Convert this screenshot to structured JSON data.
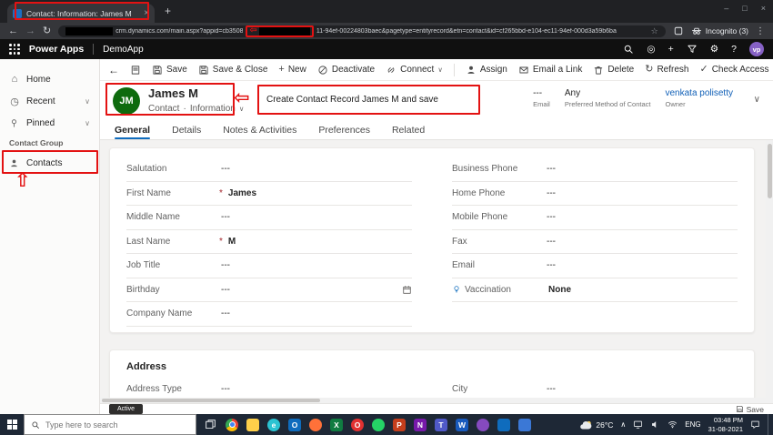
{
  "browser": {
    "tab_title": "Contact: Information: James M",
    "url": {
      "part1": "crm.dynamics.com/main.aspx?appid=cb3508",
      "part2": "11-94ef-00224803baec&pagetype=entityrecord&etn=contact&id=cf265bbd-e104-ec11-94ef-000d3a59b6ba"
    },
    "incognito_label": "Incognito (3)"
  },
  "icons": {
    "back": "←",
    "forward": "→",
    "reload": "↻",
    "close": "×",
    "new_tab": "+",
    "star": "☆",
    "menu_dots": "⋮",
    "minimize": "–",
    "maximize": "□",
    "chevron_down": "∨",
    "home": "⌂",
    "recent": "◷",
    "plus": "+",
    "gear": "⚙",
    "question": "?",
    "bullseye": "◎",
    "check": "✓",
    "refresh": "↻",
    "left_block_arrow": "⇦",
    "up_block_arrow": "⇧",
    "dot_separator": "·",
    "caret_up": "∧"
  },
  "app_header": {
    "brand": "Power Apps",
    "app_name": "DemoApp",
    "avatar_initials": "vp"
  },
  "sidebar": {
    "home": "Home",
    "recent": "Recent",
    "pinned": "Pinned",
    "group_label": "Contact Group",
    "contacts": "Contacts"
  },
  "command_bar": {
    "save": "Save",
    "save_close": "Save & Close",
    "new": "New",
    "deactivate": "Deactivate",
    "connect": "Connect",
    "assign": "Assign",
    "email_link": "Email a Link",
    "delete": "Delete",
    "refresh": "Refresh",
    "check_access": "Check Access"
  },
  "record": {
    "initials": "JM",
    "name": "James M",
    "entity": "Contact",
    "form": "Information",
    "email_value": "---",
    "email_label": "Email",
    "preferred_value": "Any",
    "preferred_label": "Preferred Method of Contact",
    "owner_value": "venkata polisetty",
    "owner_label": "Owner"
  },
  "annotations": {
    "note": "Create Contact Record James M and save"
  },
  "tabs": [
    {
      "label": "General"
    },
    {
      "label": "Details"
    },
    {
      "label": "Notes & Activities"
    },
    {
      "label": "Preferences"
    },
    {
      "label": "Related"
    }
  ],
  "form": {
    "left": [
      {
        "label": "Salutation",
        "value": "---"
      },
      {
        "label": "First Name",
        "req": "*",
        "value": "James"
      },
      {
        "label": "Middle Name",
        "value": "---"
      },
      {
        "label": "Last Name",
        "req": "*",
        "value": "M"
      },
      {
        "label": "Job Title",
        "value": "---"
      },
      {
        "label": "Birthday",
        "value": "---"
      },
      {
        "label": "Company Name",
        "value": "---"
      }
    ],
    "right": [
      {
        "label": "Business Phone",
        "value": "---"
      },
      {
        "label": "Home Phone",
        "value": "---"
      },
      {
        "label": "Mobile Phone",
        "value": "---"
      },
      {
        "label": "Fax",
        "value": "---"
      },
      {
        "label": "Email",
        "value": "---"
      },
      {
        "label": "Vaccination",
        "value": "None"
      }
    ],
    "address": {
      "title": "Address",
      "left": [
        {
          "label": "Address Type",
          "value": "---"
        }
      ],
      "right": [
        {
          "label": "City",
          "value": "---"
        }
      ]
    }
  },
  "status_bar": {
    "state": "Active",
    "save_label": "Save"
  },
  "taskbar": {
    "search_placeholder": "Type here to search",
    "weather": "26°C",
    "language": "ENG",
    "time": "03:48 PM",
    "date": "31-08-2021",
    "apps": [
      {
        "name": "chrome",
        "color": "#4285f4",
        "glyph": "",
        "shape": "circle"
      },
      {
        "name": "file-explorer",
        "color": "#ffd04a",
        "glyph": "",
        "shape": "square"
      },
      {
        "name": "edge",
        "color": "#2bc3d2",
        "glyph": "e",
        "shape": "circle"
      },
      {
        "name": "outlook",
        "color": "#0f6cbd",
        "glyph": "O",
        "shape": "square"
      },
      {
        "name": "firefox",
        "color": "#ff7139",
        "glyph": "",
        "shape": "circle"
      },
      {
        "name": "excel",
        "color": "#107c41",
        "glyph": "X",
        "shape": "square"
      },
      {
        "name": "opera",
        "color": "#e23131",
        "glyph": "O",
        "shape": "circle"
      },
      {
        "name": "whatsapp",
        "color": "#25d366",
        "glyph": "",
        "shape": "circle"
      },
      {
        "name": "powerpoint",
        "color": "#c43e1c",
        "glyph": "P",
        "shape": "square"
      },
      {
        "name": "onenote",
        "color": "#7719aa",
        "glyph": "N",
        "shape": "square"
      },
      {
        "name": "teams",
        "color": "#5059c9",
        "glyph": "T",
        "shape": "square"
      },
      {
        "name": "word",
        "color": "#185abd",
        "glyph": "W",
        "shape": "square"
      },
      {
        "name": "visual-studio",
        "color": "#864abf",
        "glyph": "",
        "shape": "circle"
      },
      {
        "name": "store",
        "color": "#0f6cbd",
        "glyph": "",
        "shape": "square"
      },
      {
        "name": "photos",
        "color": "#3b78d6",
        "glyph": "",
        "shape": "square"
      }
    ]
  }
}
